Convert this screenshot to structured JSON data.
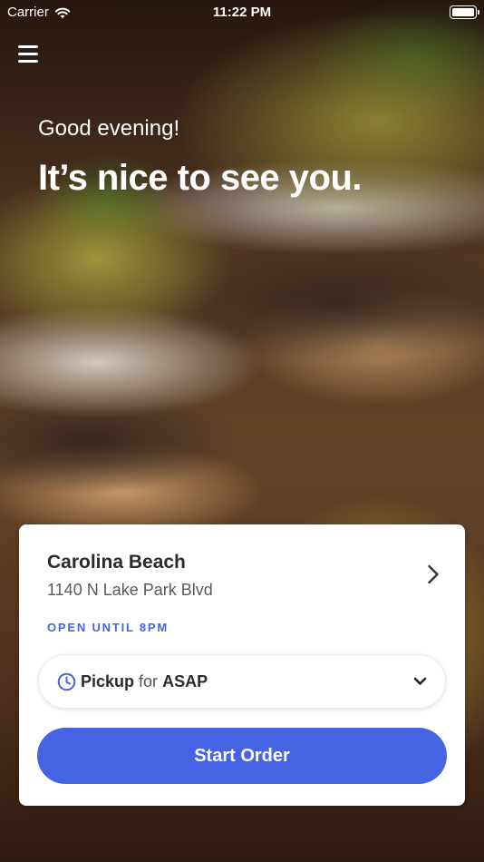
{
  "status_bar": {
    "carrier": "Carrier",
    "time": "11:22 PM",
    "wifi_icon": "wifi-icon",
    "battery_icon": "battery-icon"
  },
  "header": {
    "menu_icon": "hamburger-menu-icon",
    "greeting": "Good evening!",
    "headline": "It’s nice to see you."
  },
  "location_card": {
    "name": "Carolina Beach",
    "address": "1140 N Lake Park Blvd",
    "hours": "OPEN UNTIL 8PM",
    "detail_icon": "chevron-right-icon"
  },
  "order_mode": {
    "icon": "clock-icon",
    "mode": "Pickup",
    "connector": "for",
    "time": "ASAP",
    "dropdown_icon": "chevron-down-icon"
  },
  "start_button": {
    "label": "Start Order"
  },
  "colors": {
    "accent": "#4563e3",
    "status_text": "#4265e0",
    "card_background": "#ffffff"
  }
}
